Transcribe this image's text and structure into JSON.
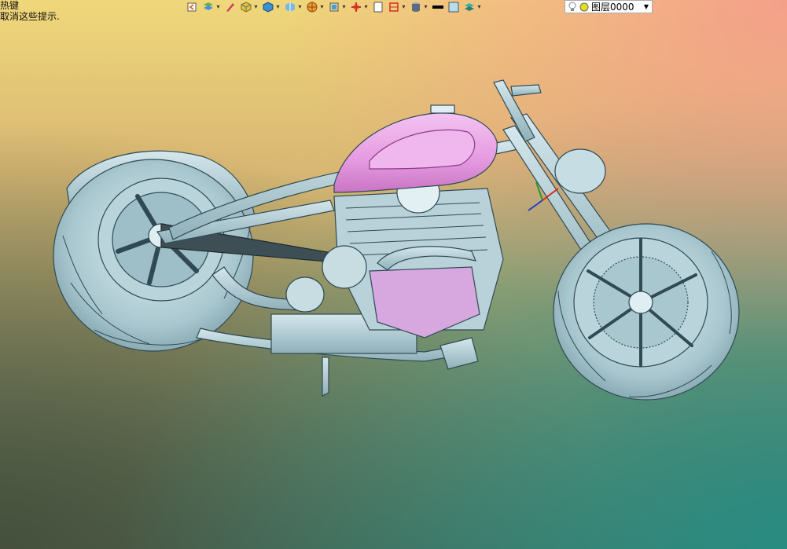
{
  "hint": {
    "line1": "热键",
    "line2": "取消这些提示."
  },
  "toolbar": {
    "icons": [
      "undo-icon",
      "layers-icon",
      "pencil-icon",
      "solid-box-icon",
      "box-view-icon",
      "render-icon",
      "frame-icon",
      "section-icon",
      "page-icon",
      "dimension-icon",
      "cylinder-icon",
      "line-color-icon",
      "fill-color-icon",
      "layer-stack-icon"
    ]
  },
  "layer_select": {
    "value": "图层0000",
    "colors": {
      "bulb": "#f4d23a",
      "dot": "#d4e000"
    }
  },
  "model": {
    "name": "chopper-motorcycle",
    "colors": {
      "body": "#a9c7cf",
      "outline": "#304a54",
      "tank": "#e59ae0"
    }
  }
}
